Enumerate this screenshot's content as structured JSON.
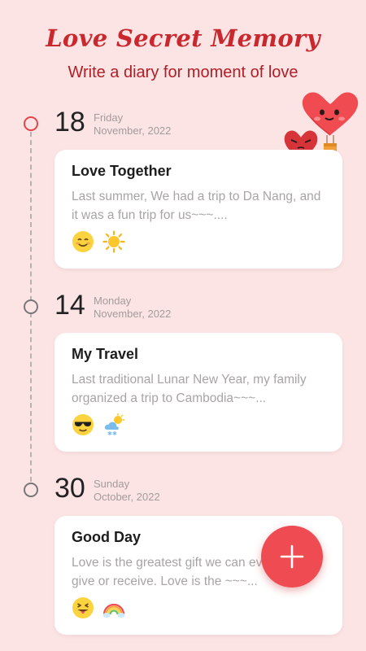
{
  "header": {
    "title": "Love Secret Memory",
    "subtitle": "Write a diary for moment of love"
  },
  "colors": {
    "accent": "#ee4c52",
    "title": "#c8282e",
    "background": "#fde4e4"
  },
  "entries": [
    {
      "day": "18",
      "weekday": "Friday",
      "month_year": "November, 2022",
      "title": "Love Together",
      "body": "Last summer, We had a trip to Da Nang, and it was a fun trip for us~~~....",
      "mood_icon": "smiling-face-icon",
      "weather_icon": "sun-icon"
    },
    {
      "day": "14",
      "weekday": "Monday",
      "month_year": "November, 2022",
      "title": "My Travel",
      "body": "Last traditional Lunar New Year, my family organized a trip to Cambodia~~~...",
      "mood_icon": "sunglasses-face-icon",
      "weather_icon": "snow-cloud-sun-icon"
    },
    {
      "day": "30",
      "weekday": "Sunday",
      "month_year": "October, 2022",
      "title": "Good Day",
      "body": "Love is the greatest gift we can ever hope to give or receive. Love is the ~~~...",
      "mood_icon": "tongue-face-icon",
      "weather_icon": "rainbow-icon"
    }
  ],
  "fab": {
    "icon": "plus-icon"
  }
}
